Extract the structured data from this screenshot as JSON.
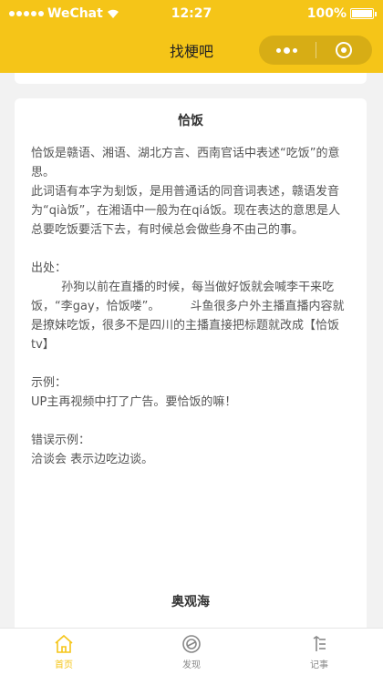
{
  "statusbar": {
    "carrier": "WeChat",
    "time": "12:27",
    "battery": "100%"
  },
  "nav": {
    "title": "找梗吧"
  },
  "card": {
    "title": "恰饭",
    "body": "恰饭是赣语、湘语、湖北方言、西南官话中表述“吃饭”的意思。\n此词语有本字为刬饭，是用普通话的同音词表述，赣语发音为“qià饭”，在湘语中一般为在qiá饭。现在表达的意思是人总要吃饭要活下去，有时候总会做些身不由己的事。\n\n出处：\n        孙狗以前在直播的时候，每当做好饭就会喊李干来吃饭，“李gay，恰饭喽”。        斗鱼很多户外主播直播内容就是撩妹吃饭，很多不是四川的主播直接把标题就改成【恰饭tv】\n\n示例：\nUP主再视频中打了广告。要恰饭的嘛！\n\n错误示例：\n洽谈会 表示边吃边谈。"
  },
  "next_card": {
    "title": "奥观海"
  },
  "tabbar": {
    "items": [
      {
        "label": "首页",
        "icon": "home-icon",
        "active": true
      },
      {
        "label": "发现",
        "icon": "discover-icon",
        "active": false
      },
      {
        "label": "记事",
        "icon": "notes-icon",
        "active": false
      }
    ]
  },
  "colors": {
    "accent": "#f5c518",
    "background": "#f2f2f2"
  }
}
